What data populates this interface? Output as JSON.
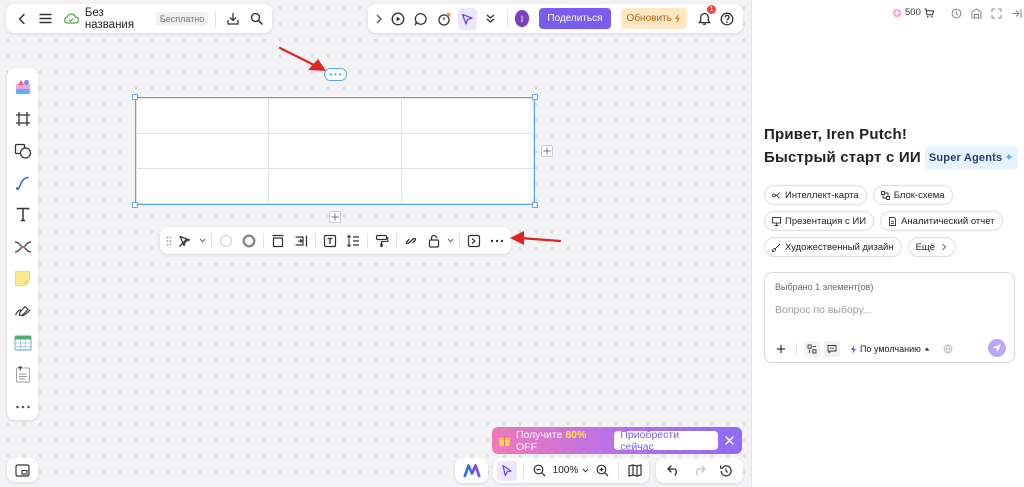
{
  "app": {
    "doc_title": "Без названия",
    "plan_badge": "Бесплатно",
    "share_label": "Поделиться",
    "upgrade_label": "Обновить",
    "notification_count": "1",
    "avatar_letter": "I"
  },
  "promo": {
    "text_before": "Получите ",
    "discount": "80%",
    "text_after": " OFF",
    "button": "Приобрести сейчас"
  },
  "zoom": "100%",
  "panel": {
    "credits": "500",
    "greeting_line1": "Привет, Iren Putch!",
    "greeting_line2": "Быстрый старт с ИИ",
    "agents_badge": "Super Agents",
    "chips": [
      {
        "label": "Интеллект-карта",
        "icon": "mindmap-icon"
      },
      {
        "label": "Блок-схема",
        "icon": "flowchart-icon"
      },
      {
        "label": "Презентация с ИИ",
        "icon": "presentation-icon"
      },
      {
        "label": "Аналитический отчет",
        "icon": "report-icon"
      },
      {
        "label": "Художественный дизайн",
        "icon": "brush-icon"
      },
      {
        "label": "Ещё",
        "icon": "chevron-right-icon"
      }
    ],
    "selected_text": "Выбрано 1 элемент(ов)",
    "input_placeholder": "Вопрос по выбору...",
    "model_label": "По умолчанию"
  },
  "colors": {
    "accent": "#7a5cf0",
    "selection": "#5aa7ee",
    "annotation_arrow": "#e02424"
  }
}
